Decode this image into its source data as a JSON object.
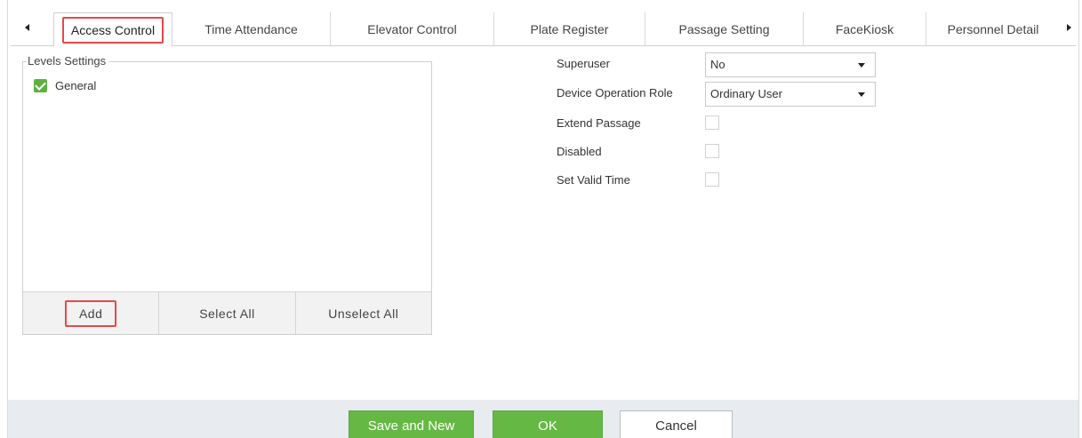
{
  "tabs": [
    {
      "label": "Access Control",
      "active": true
    },
    {
      "label": "Time Attendance"
    },
    {
      "label": "Elevator Control"
    },
    {
      "label": "Plate Register"
    },
    {
      "label": "Passage Setting"
    },
    {
      "label": "FaceKiosk"
    },
    {
      "label": "Personnel Detail"
    }
  ],
  "levels": {
    "legend": "Levels Settings",
    "items": [
      {
        "label": "General",
        "checked": true
      }
    ],
    "buttons": {
      "add": "Add",
      "select_all": "Select All",
      "unselect_all": "Unselect All"
    }
  },
  "form": {
    "superuser": {
      "label": "Superuser",
      "value": "No"
    },
    "device_role": {
      "label": "Device Operation Role",
      "value": "Ordinary User"
    },
    "extend_passage": {
      "label": "Extend Passage",
      "checked": false
    },
    "disabled": {
      "label": "Disabled",
      "checked": false
    },
    "set_valid_time": {
      "label": "Set Valid Time",
      "checked": false
    }
  },
  "footer": {
    "save_new": "Save and New",
    "ok": "OK",
    "cancel": "Cancel"
  },
  "colors": {
    "accent_green": "#66b845",
    "highlight_red": "#e5484d"
  }
}
